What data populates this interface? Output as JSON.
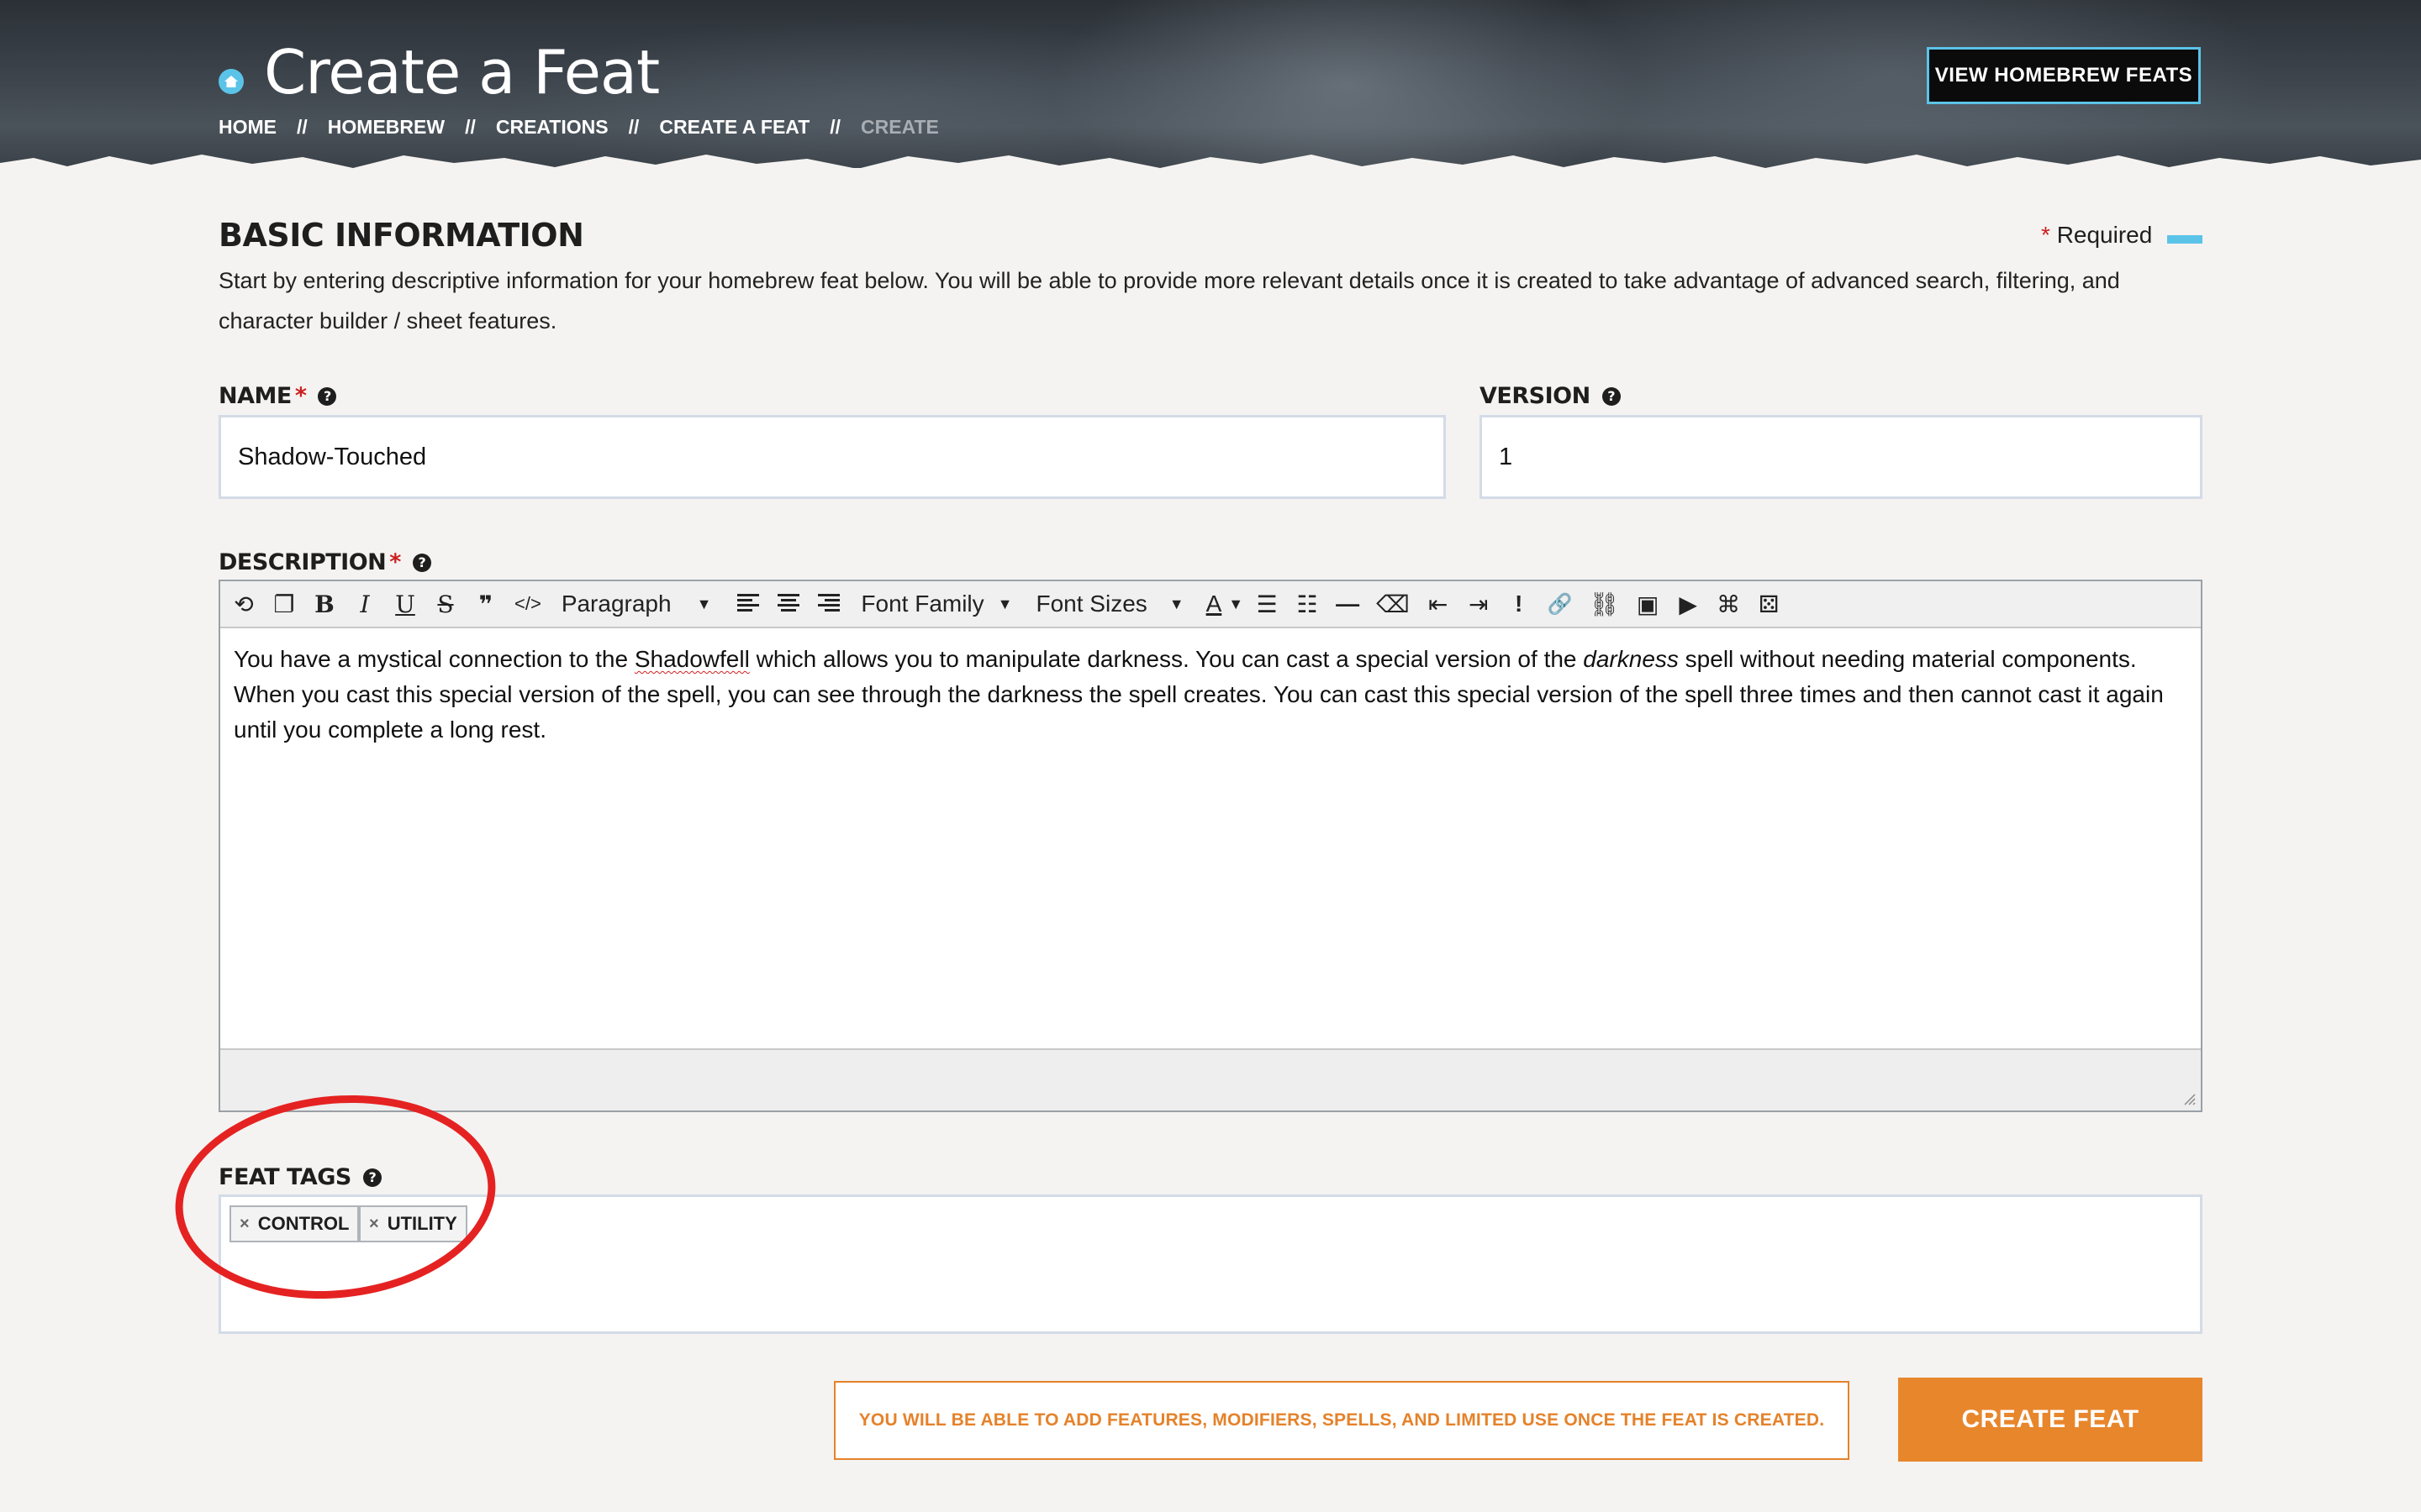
{
  "header": {
    "title": "Create a Feat",
    "breadcrumb": [
      "HOME",
      "HOMEBREW",
      "CREATIONS",
      "CREATE A FEAT",
      "CREATE"
    ],
    "separator": "//",
    "view_button": "VIEW HOMEBREW FEATS"
  },
  "basic_info": {
    "title": "BASIC INFORMATION",
    "required_star": "*",
    "required_label": "Required",
    "intro": "Start by entering descriptive information for your homebrew feat below. You will be able to provide more relevant details once it is created to take advantage of advanced search, filtering, and character builder / sheet features."
  },
  "fields": {
    "name_label": "NAME",
    "name_value": "Shadow-Touched",
    "version_label": "VERSION",
    "version_value": "1",
    "description_label": "DESCRIPTION",
    "tags_label": "FEAT TAGS",
    "required_star": "*",
    "help_glyph": "?"
  },
  "editor": {
    "toolbar": {
      "undo": "⟲",
      "paste": "❐",
      "bold": "B",
      "italic": "I",
      "underline": "U",
      "strikethrough": "S",
      "blockquote": "❞",
      "code": "</>",
      "paragraph": "Paragraph",
      "font_family": "Font Family",
      "font_sizes": "Font Sizes",
      "caret": "▼",
      "font_color": "A",
      "bullets": "☰",
      "numbered": "☷",
      "hr": "—",
      "eraser": "⌫",
      "outdent": "⇤",
      "indent": "⇥",
      "exclaim": "!",
      "link": "🔗",
      "unlink": "⛓",
      "image": "▣",
      "video": "▶",
      "source": "⌘",
      "dice": "⚄"
    },
    "content": {
      "part1": "You have a mystical connection to the ",
      "shadowfell": "Shadowfell",
      "part2": " which allows you to manipulate darkness. You can cast a special version of the ",
      "darkness": "darkness",
      "part3": " spell without needing material components. When you cast this special version of the spell, you can see through the darkness the spell creates. You can cast this special version of the spell three times and then cannot cast it again until you complete a long rest."
    }
  },
  "tags": [
    {
      "remove": "×",
      "label": "CONTROL"
    },
    {
      "remove": "×",
      "label": "UTILITY"
    }
  ],
  "notice": "YOU WILL BE ABLE TO ADD FEATURES, MODIFIERS, SPELLS, AND LIMITED USE ONCE THE FEAT IS CREATED.",
  "create_button": "CREATE FEAT",
  "colors": {
    "accent_blue": "#5bc3e8",
    "accent_orange": "#e8862c",
    "required_red": "#cc1f1f",
    "annotation_red": "#e52222"
  }
}
